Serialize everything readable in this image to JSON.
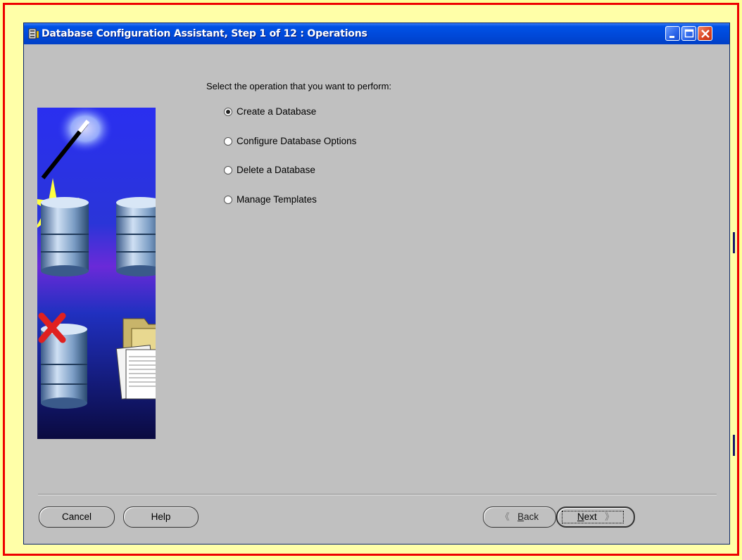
{
  "window": {
    "title": "Database Configuration Assistant, Step 1 of 12 : Operations",
    "icon": "database-icon",
    "controls": [
      "minimize-icon",
      "maximize-icon",
      "close-icon"
    ]
  },
  "main": {
    "prompt": "Select the operation that you want to perform:",
    "options": [
      {
        "label": "Create a Database",
        "selected": true
      },
      {
        "label": "Configure Database Options",
        "selected": false
      },
      {
        "label": "Delete a Database",
        "selected": false
      },
      {
        "label": "Manage Templates",
        "selected": false
      }
    ]
  },
  "buttons": {
    "cancel": "Cancel",
    "help": "Help",
    "back_arrow": "《",
    "back_mnemonic": "B",
    "back_rest": "ack",
    "next_mnemonic": "N",
    "next_rest": "ext",
    "next_arrow": "》"
  },
  "colors": {
    "frame_border": "#ee0000",
    "frame_fill": "#ffffa8",
    "titlebar": "#0052e6",
    "window_bg": "#c0c0c0"
  }
}
